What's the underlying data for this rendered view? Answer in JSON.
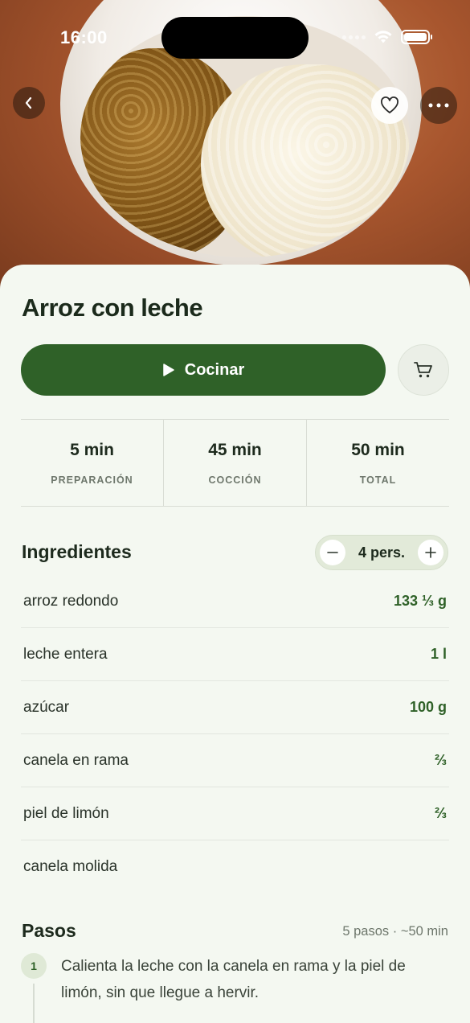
{
  "status_bar": {
    "time": "16:00"
  },
  "recipe": {
    "title": "Arroz con leche",
    "cook_label": "Cocinar",
    "times": [
      {
        "value": "5 min",
        "label": "PREPARACIÓN"
      },
      {
        "value": "45 min",
        "label": "COCCIÓN"
      },
      {
        "value": "50 min",
        "label": "TOTAL"
      }
    ]
  },
  "ingredients": {
    "title": "Ingredientes",
    "servings": "4 pers.",
    "items": [
      {
        "name": "arroz redondo",
        "qty": "133 ⅓ g"
      },
      {
        "name": "leche entera",
        "qty": "1 l"
      },
      {
        "name": "azúcar",
        "qty": "100 g"
      },
      {
        "name": "canela en rama",
        "qty": "⅔"
      },
      {
        "name": "piel de limón",
        "qty": "⅔"
      },
      {
        "name": "canela molida",
        "qty": ""
      }
    ]
  },
  "steps": {
    "title": "Pasos",
    "meta": "5 pasos · ~50 min",
    "items": [
      {
        "number": "1",
        "text": "Calienta la leche con la canela en rama y la piel de limón, sin que llegue a hervir."
      }
    ]
  },
  "icons": {
    "back": "chevron-left-icon",
    "favorite": "heart-icon",
    "more": "ellipsis-icon",
    "play": "play-icon",
    "cart": "cart-icon",
    "minus": "minus-icon",
    "plus": "plus-icon"
  },
  "colors": {
    "accent": "#2f6128",
    "background": "#f4f8f1",
    "quantity": "#2f6128"
  }
}
